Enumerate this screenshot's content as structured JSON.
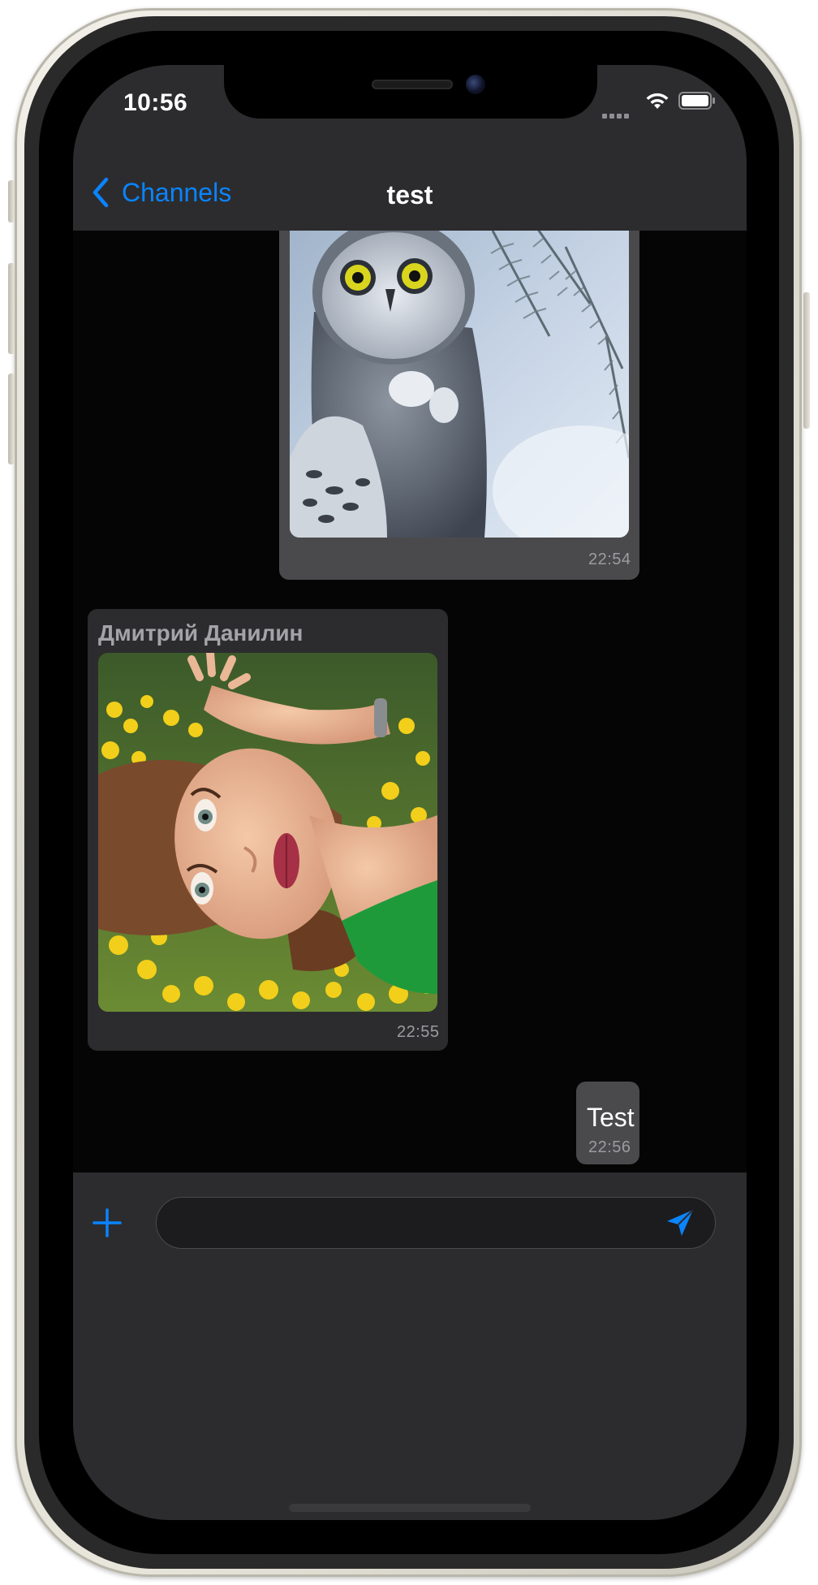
{
  "status_bar": {
    "time": "10:56"
  },
  "nav": {
    "back_label": "Channels",
    "title": "test"
  },
  "messages": [
    {
      "direction": "outgoing",
      "type": "image",
      "image": "snowy-owl-photo",
      "time": "22:54"
    },
    {
      "direction": "incoming",
      "type": "image",
      "sender": "Дмитрий Данилин",
      "image": "woman-in-yellow-flowers-photo",
      "time": "22:55"
    },
    {
      "direction": "outgoing",
      "type": "text",
      "text": "Test",
      "time": "22:56"
    }
  ],
  "input": {
    "placeholder": "",
    "value": ""
  },
  "icons": {
    "back": "chevron-left-icon",
    "attach": "plus-icon",
    "send": "paper-plane-icon",
    "wifi": "wifi-icon",
    "battery": "battery-icon",
    "signal": "signal-icon"
  },
  "colors": {
    "accent": "#0a84ff",
    "bar_background": "#2c2c2e",
    "chat_background": "#050505",
    "outgoing_bubble": "#4a4a4c",
    "incoming_bubble": "#2c2c2e"
  }
}
